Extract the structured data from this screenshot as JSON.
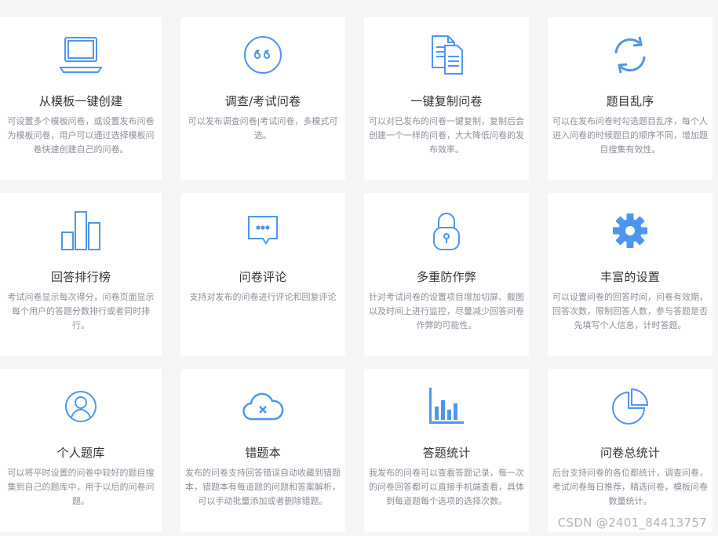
{
  "accent_color": "#4d96f0",
  "features": [
    {
      "icon": "laptop-icon",
      "title": "从模板一键创建",
      "desc": "可设置多个模板问卷，或设置发布问卷为模板问卷，用户可以通过选择模板问卷快速创建自己的问卷。"
    },
    {
      "icon": "quote-icon",
      "title": "调查/考试问卷",
      "desc": "可以发布调查问卷|考试问卷，多模式可选。"
    },
    {
      "icon": "copy-document-icon",
      "title": "一键复制问卷",
      "desc": "可以对已发布的问卷一键复制，复制后会创建一个一样的问卷，大大降低问卷的发布效率。"
    },
    {
      "icon": "shuffle-refresh-icon",
      "title": "题目乱序",
      "desc": "可以在发布问卷时勾选题目乱序，每个人进入问卷的时候题目的顺序不同，增加题目搜集有效性。"
    },
    {
      "icon": "bar-ranking-icon",
      "title": "回答排行榜",
      "desc": "考试问卷显示每次得分，问卷页面显示每个用户的答题分数排行或者同时排行。"
    },
    {
      "icon": "comment-icon",
      "title": "问卷评论",
      "desc": "支持对发布的问卷进行评论和回复评论"
    },
    {
      "icon": "lock-icon",
      "title": "多重防作弊",
      "desc": "针对考试问卷的设置项目增加切屏、截图以及时间上进行监控，尽量减少回答问卷作弊的可能性。"
    },
    {
      "icon": "gear-icon",
      "title": "丰富的设置",
      "desc": "可以设置问卷的回答时间，问卷有效期，回答次数，限制回答人数，参与答题是否先填写个人信息，计时答题。"
    },
    {
      "icon": "user-icon",
      "title": "个人题库",
      "desc": "可以将平时设置的问卷中较好的题目搜集到自己的题库中，用于以后的问卷问题。"
    },
    {
      "icon": "cloud-error-icon",
      "title": "错题本",
      "desc": "发布的问卷支持回答错误自动收藏到错题本，错题本有每道题的问题和答案解析，可以手动批量添加或者删除错题。"
    },
    {
      "icon": "bar-chart-icon",
      "title": "答题统计",
      "desc": "我发布的问卷可以查看答题记录，每一次的问卷回答都可以直接手机端查看，具体到每道题每个选项的选择次数。"
    },
    {
      "icon": "pie-chart-icon",
      "title": "问卷总统计",
      "desc": "后台支持问卷的各位都统计，调查问卷，考试问卷每日推荐，精选问卷，模板问卷数量统计。"
    }
  ],
  "watermark": "CSDN @2401_84413757"
}
